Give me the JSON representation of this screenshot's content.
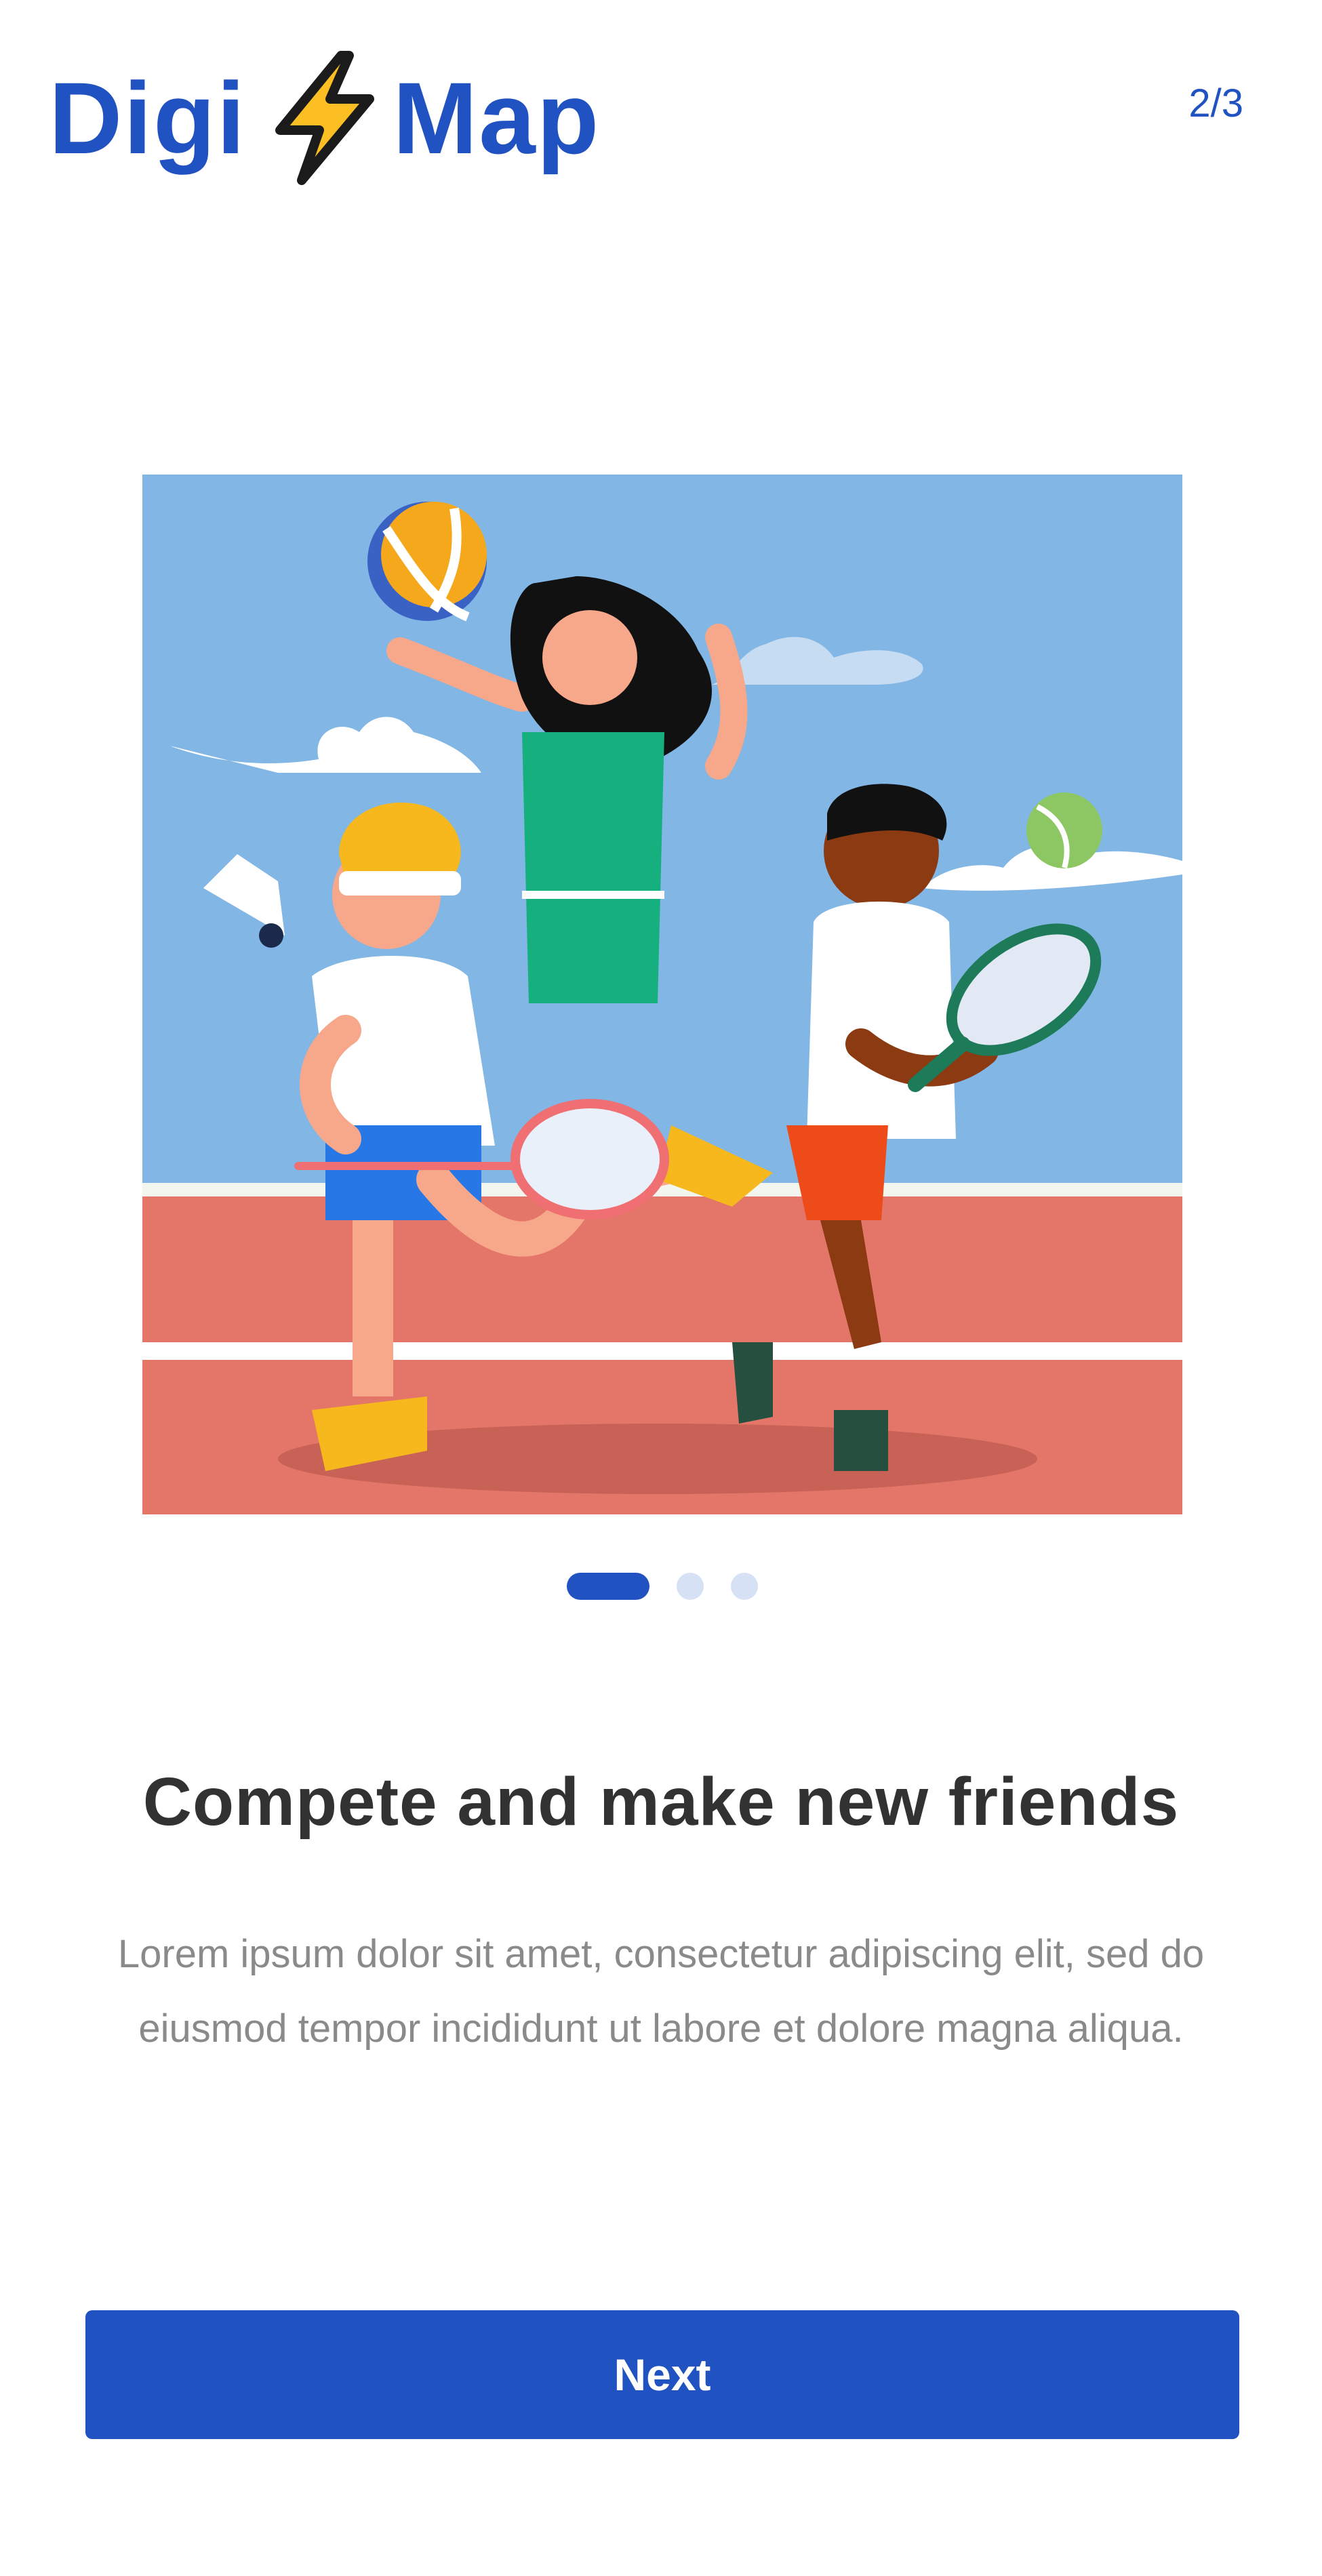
{
  "app": {
    "logo_left": "Digi",
    "logo_right": "Map",
    "logo_icon": "lightning-bolt-icon"
  },
  "header": {
    "page_indicator": "2/3"
  },
  "onboarding": {
    "illustration": "kids-playing-sports-illustration",
    "pagination": {
      "total": 3,
      "active": 1
    },
    "title": "Compete and make new friends",
    "description": "Lorem ipsum dolor sit amet, consectetur adipiscing elit, sed do eiusmod tempor incididunt ut labore et dolore magna aliqua.",
    "next_label": "Next"
  },
  "colors": {
    "brand": "#2152C1",
    "bolt": "#FBBF24",
    "title_text": "#323232",
    "body_text": "#8A8A8A",
    "dot_inactive": "#D6E1F5"
  }
}
